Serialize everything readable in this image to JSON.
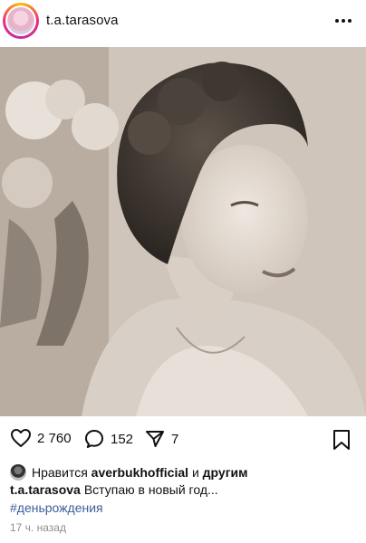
{
  "post": {
    "username": "t.a.tarasova",
    "more_icon": "more-horizontal-icon",
    "image_alt": "Black and white portrait photo"
  },
  "actions": {
    "likes_count": "2 760",
    "comments_count": "152",
    "shares_count": "7"
  },
  "liked_by": {
    "prefix": "Нравится",
    "user": "averbukhofficial",
    "conjunction": "и",
    "others": "другим"
  },
  "caption": {
    "username": "t.a.tarasova",
    "text": "Вступаю в новый год..."
  },
  "hashtag": "#деньрождения",
  "timestamp": "17 ч. назад"
}
